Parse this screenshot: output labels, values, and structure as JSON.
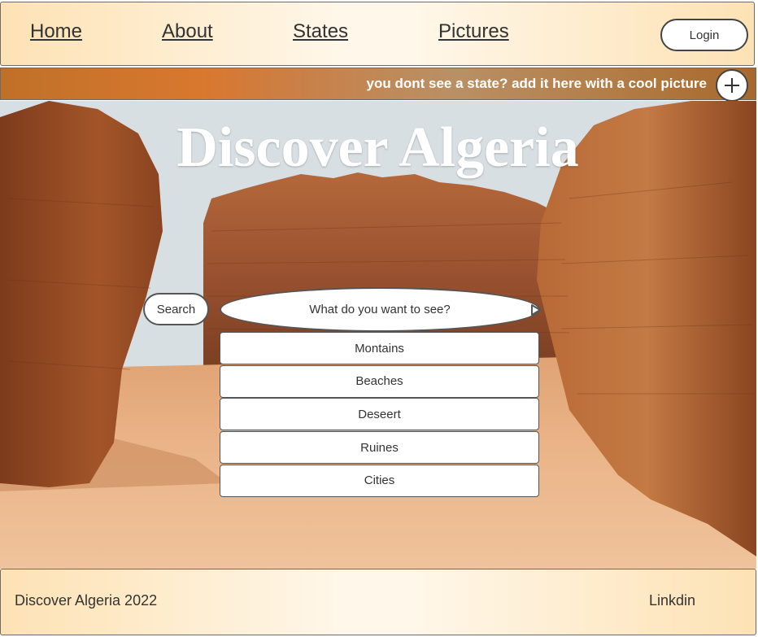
{
  "nav": {
    "links": [
      {
        "label": "Home"
      },
      {
        "label": "About"
      },
      {
        "label": "States"
      },
      {
        "label": "Pictures"
      }
    ],
    "login_label": "Login"
  },
  "banner": {
    "text": "you dont see a state? add it here with a cool picture",
    "add_icon": "plus-icon"
  },
  "hero": {
    "title": "Discover Algeria",
    "search_button_label": "Search",
    "search_placeholder": "What do you want to see?",
    "search_value": "",
    "options": [
      {
        "label": "Montains"
      },
      {
        "label": "Beaches"
      },
      {
        "label": "Deseert"
      },
      {
        "label": "Ruines"
      },
      {
        "label": "Cities"
      }
    ]
  },
  "footer": {
    "brand": "Discover Algeria  2022",
    "link": "Linkdin"
  },
  "colors": {
    "nav_bg": "#fde2b4",
    "banner_orange": "#d9782f",
    "text_dark": "#333333",
    "rock": "#a5562a",
    "sand": "#e8a870"
  }
}
